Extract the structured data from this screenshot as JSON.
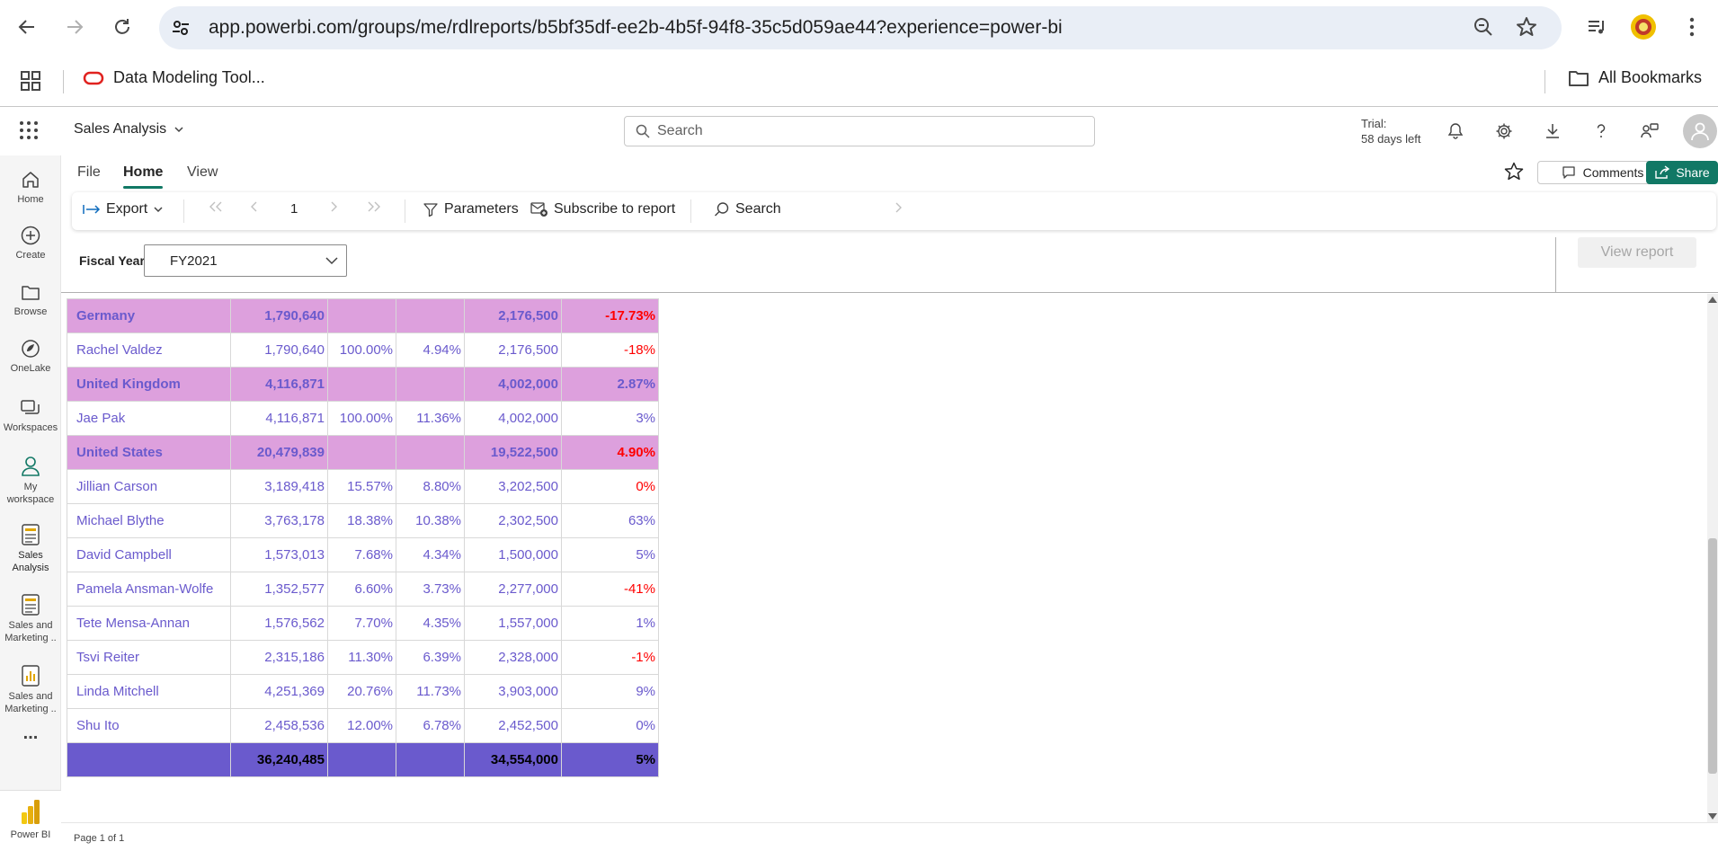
{
  "browser": {
    "url": "app.powerbi.com/groups/me/rdlreports/b5bf35df-ee2b-4b5f-94f8-35c5d059ae44?experience=power-bi",
    "bookmark": "Data Modeling Tool...",
    "all_bookmarks": "All Bookmarks"
  },
  "header": {
    "workspace_title": "Sales Analysis",
    "search_placeholder": "Search",
    "trial_line1": "Trial:",
    "trial_line2": "58 days left"
  },
  "leftnav": {
    "home": "Home",
    "create": "Create",
    "browse": "Browse",
    "onelake": "OneLake",
    "workspaces": "Workspaces",
    "my_workspace_1": "My",
    "my_workspace_2": "workspace",
    "sales_analysis_1": "Sales",
    "sales_analysis_2": "Analysis",
    "sales_marketing_a_1": "Sales and",
    "sales_marketing_a_2": "Marketing ..",
    "sales_marketing_b_1": "Sales and",
    "sales_marketing_b_2": "Marketing ..",
    "more": "...",
    "powerbi": "Power BI"
  },
  "ribbon": {
    "tabs": [
      "File",
      "Home",
      "View"
    ],
    "comments": "Comments",
    "share": "Share",
    "export": "Export",
    "page_number": "1",
    "parameters": "Parameters",
    "subscribe": "Subscribe to report",
    "search": "Search"
  },
  "params": {
    "label": "Fiscal Year",
    "value": "FY2021",
    "view_report": "View report"
  },
  "colors": {
    "group_bg": "#dda0dd",
    "text_purple": "#6a5acd",
    "total_bg": "#6a5acd",
    "negative": "#ff0000",
    "share_green": "#117865"
  },
  "report": {
    "rows": [
      {
        "type": "group",
        "name": "Germany",
        "sales": "1,790,640",
        "pct_country": "",
        "pct_total": "",
        "quota": "2,176,500",
        "variance": "-17.73%",
        "negative": true
      },
      {
        "type": "person",
        "name": "Rachel Valdez",
        "sales": "1,790,640",
        "pct_country": "100.00%",
        "pct_total": "4.94%",
        "quota": "2,176,500",
        "variance": "-18%",
        "negative": true
      },
      {
        "type": "group",
        "name": "United Kingdom",
        "sales": "4,116,871",
        "pct_country": "",
        "pct_total": "",
        "quota": "4,002,000",
        "variance": "2.87%",
        "negative": false
      },
      {
        "type": "person",
        "name": "Jae Pak",
        "sales": "4,116,871",
        "pct_country": "100.00%",
        "pct_total": "11.36%",
        "quota": "4,002,000",
        "variance": "3%",
        "negative": false
      },
      {
        "type": "group",
        "name": "United States",
        "sales": "20,479,839",
        "pct_country": "",
        "pct_total": "",
        "quota": "19,522,500",
        "variance": "4.90%",
        "negative": true
      },
      {
        "type": "person",
        "name": "Jillian Carson",
        "sales": "3,189,418",
        "pct_country": "15.57%",
        "pct_total": "8.80%",
        "quota": "3,202,500",
        "variance": "0%",
        "negative": true
      },
      {
        "type": "person",
        "name": "Michael Blythe",
        "sales": "3,763,178",
        "pct_country": "18.38%",
        "pct_total": "10.38%",
        "quota": "2,302,500",
        "variance": "63%",
        "negative": false
      },
      {
        "type": "person",
        "name": "David Campbell",
        "sales": "1,573,013",
        "pct_country": "7.68%",
        "pct_total": "4.34%",
        "quota": "1,500,000",
        "variance": "5%",
        "negative": false
      },
      {
        "type": "person",
        "name": "Pamela Ansman-Wolfe",
        "sales": "1,352,577",
        "pct_country": "6.60%",
        "pct_total": "3.73%",
        "quota": "2,277,000",
        "variance": "-41%",
        "negative": true
      },
      {
        "type": "person",
        "name": "Tete Mensa-Annan",
        "sales": "1,576,562",
        "pct_country": "7.70%",
        "pct_total": "4.35%",
        "quota": "1,557,000",
        "variance": "1%",
        "negative": false
      },
      {
        "type": "person",
        "name": "Tsvi Reiter",
        "sales": "2,315,186",
        "pct_country": "11.30%",
        "pct_total": "6.39%",
        "quota": "2,328,000",
        "variance": "-1%",
        "negative": true
      },
      {
        "type": "person",
        "name": "Linda Mitchell",
        "sales": "4,251,369",
        "pct_country": "20.76%",
        "pct_total": "11.73%",
        "quota": "3,903,000",
        "variance": "9%",
        "negative": false
      },
      {
        "type": "person",
        "name": "Shu Ito",
        "sales": "2,458,536",
        "pct_country": "12.00%",
        "pct_total": "6.78%",
        "quota": "2,452,500",
        "variance": "0%",
        "negative": false
      }
    ],
    "total": {
      "sales": "36,240,485",
      "quota": "34,554,000",
      "variance": "5%"
    }
  },
  "status": {
    "page_label": "Page 1 of 1"
  }
}
